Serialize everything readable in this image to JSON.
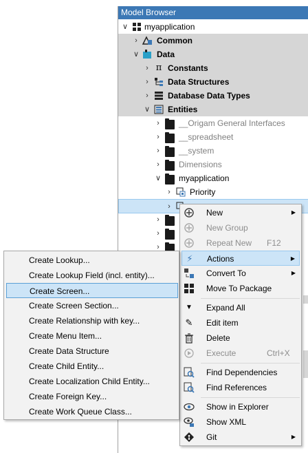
{
  "browser": {
    "title": "Model Browser",
    "tree": {
      "root": "myapplication",
      "common": "Common",
      "data": "Data",
      "constants": "Constants",
      "data_structures": "Data Structures",
      "database_data_types": "Database Data Types",
      "entities": "Entities",
      "origam_general_interfaces": "__Origam General Interfaces",
      "spreadsheet": "__spreadsheet",
      "system": "__system",
      "dimensions": "Dimensions",
      "myapplication_folder": "myapplication",
      "priority": "Priority"
    }
  },
  "context_menu": {
    "items": [
      {
        "label": "New",
        "icon": "new-icon",
        "arrow": true,
        "disabled": false
      },
      {
        "label": "New Group",
        "icon": "new-group-icon",
        "disabled": true
      },
      {
        "label": "Repeat New",
        "shortcut": "F12",
        "icon": "repeat-new-icon",
        "disabled": true
      },
      {
        "label": "Actions",
        "icon": "lightning-icon",
        "arrow": true,
        "highlighted": true
      },
      {
        "label": "Convert To",
        "icon": "convert-icon",
        "arrow": true
      },
      {
        "label": "Move To Package",
        "icon": "package-icon"
      },
      {
        "label": "Expand All",
        "icon": "expand-icon"
      },
      {
        "label": "Edit item",
        "icon": "pencil-icon"
      },
      {
        "label": "Delete",
        "icon": "delete-icon"
      },
      {
        "label": "Execute",
        "shortcut": "Ctrl+X",
        "icon": "execute-icon",
        "disabled": true
      },
      {
        "label": "Find Dependencies",
        "icon": "find-dependencies-icon"
      },
      {
        "label": "Find References",
        "icon": "find-references-icon"
      },
      {
        "label": "Show in Explorer",
        "icon": "eye-icon"
      },
      {
        "label": "Show XML",
        "icon": "xml-icon"
      },
      {
        "label": "Git",
        "icon": "git-icon",
        "arrow": true
      }
    ]
  },
  "actions_submenu": {
    "items": [
      "Create Lookup...",
      "Create Lookup Field (incl. entity)...",
      "Create Screen...",
      "Create Screen Section...",
      "Create Relationship with key...",
      "Create Menu Item...",
      "Create Data Structure",
      "Create Child Entity...",
      "Create Localization Child Entity...",
      "Create Foreign Key...",
      "Create Work Queue Class..."
    ],
    "highlighted_index": 2
  },
  "colors": {
    "title_bar": "#3c78b5",
    "highlight": "#cce4f7",
    "highlight_border": "#99c9ef",
    "menu_bg": "#f2f2f2"
  }
}
